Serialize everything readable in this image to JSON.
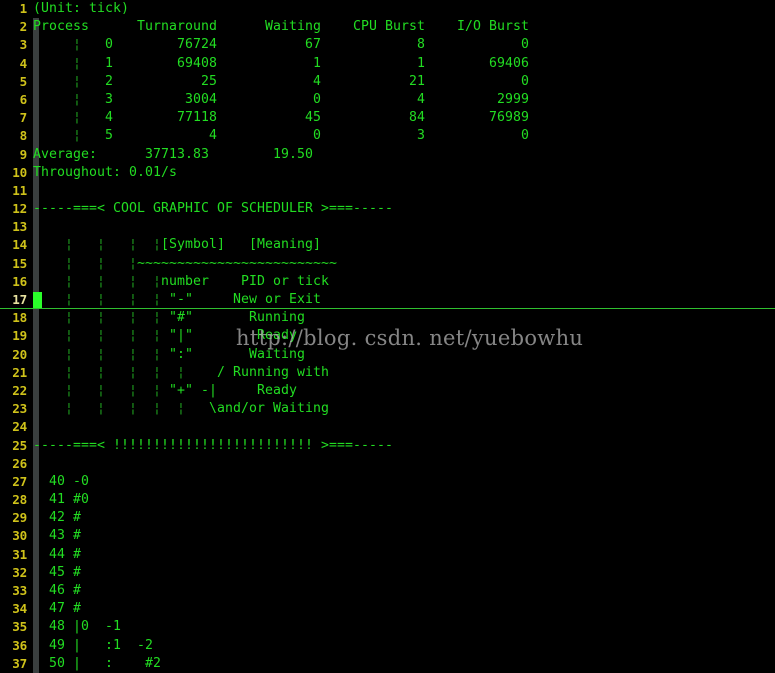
{
  "editor": {
    "kind": "terminal-text-editor",
    "background_color": "#000000",
    "text_color": "#22dd22",
    "linenumber_color": "#cfc21a",
    "cursorline_number_color": "#e8e2a0",
    "cursor_color": "#2aff2a",
    "indent_guide_color": "#3a3f3f",
    "cursor_line": 17,
    "first_line": 1,
    "last_line": 37
  },
  "watermark": {
    "text": "http://blog. csdn. net/yuebowhu"
  },
  "stats": {
    "unit_line": "(Unit: tick)",
    "columns": [
      "Process",
      "Turnaround",
      "Waiting",
      "CPU Burst",
      "I/O Burst"
    ],
    "rows": [
      {
        "process": "0",
        "turnaround": "76724",
        "waiting": "67",
        "cpu_burst": "8",
        "io_burst": "0"
      },
      {
        "process": "1",
        "turnaround": "69408",
        "waiting": "1",
        "cpu_burst": "1",
        "io_burst": "69406"
      },
      {
        "process": "2",
        "turnaround": "25",
        "waiting": "4",
        "cpu_burst": "21",
        "io_burst": "0"
      },
      {
        "process": "3",
        "turnaround": "3004",
        "waiting": "0",
        "cpu_burst": "4",
        "io_burst": "2999"
      },
      {
        "process": "4",
        "turnaround": "77118",
        "waiting": "45",
        "cpu_burst": "84",
        "io_burst": "76989"
      },
      {
        "process": "5",
        "turnaround": "4",
        "waiting": "0",
        "cpu_burst": "3",
        "io_burst": "0"
      }
    ],
    "average_label": "Average:",
    "average_turnaround": "37713.83",
    "average_waiting": "19.50",
    "throughout_line": "Throughout: 0.01/s"
  },
  "banners": {
    "graphic": "-----===< COOL GRAPHIC OF SCHEDULER >===-----",
    "bangs": "-----===< !!!!!!!!!!!!!!!!!!!!!!!!! >===-----"
  },
  "legend": {
    "header_symbol": "[Symbol]",
    "header_meaning": "[Meaning]",
    "rule": "~~~~~~~~~~~~~~~~~~~~~~~~",
    "entries": [
      {
        "symbol": "number",
        "meaning": "PID or tick"
      },
      {
        "symbol": "\"-\"",
        "meaning": "New or Exit"
      },
      {
        "symbol": "\"#\"",
        "meaning": "Running"
      },
      {
        "symbol": "\"|\"",
        "meaning": "Ready"
      },
      {
        "symbol": "\":\"",
        "meaning": "Waiting"
      },
      {
        "symbol": "\"+\"",
        "meaning": "/ Running with -| Ready \\and/or Waiting"
      }
    ]
  },
  "lines": [
    {
      "n": "1",
      "text": "(Unit: tick)",
      "indentbar": false,
      "cursor": false
    },
    {
      "n": "2",
      "text": "Process      Turnaround      Waiting    CPU Burst    I/O Burst",
      "indentbar": true,
      "cursor": false
    },
    {
      "n": "3",
      "text": "     ¦   0        76724           67            8            0",
      "indentbar": true,
      "cursor": false
    },
    {
      "n": "4",
      "text": "     ¦   1        69408            1            1        69406",
      "indentbar": true,
      "cursor": false
    },
    {
      "n": "5",
      "text": "     ¦   2           25            4           21            0",
      "indentbar": true,
      "cursor": false
    },
    {
      "n": "6",
      "text": "     ¦   3         3004            0            4         2999",
      "indentbar": true,
      "cursor": false
    },
    {
      "n": "7",
      "text": "     ¦   4        77118           45           84        76989",
      "indentbar": true,
      "cursor": false
    },
    {
      "n": "8",
      "text": "     ¦   5            4            0            3            0",
      "indentbar": true,
      "cursor": false
    },
    {
      "n": "9",
      "text": "Average:      37713.83        19.50",
      "indentbar": true,
      "cursor": false
    },
    {
      "n": "10",
      "text": "Throughout: 0.01/s",
      "indentbar": true,
      "cursor": false
    },
    {
      "n": "11",
      "text": "",
      "indentbar": true,
      "cursor": false
    },
    {
      "n": "12",
      "text": "-----===< COOL GRAPHIC OF SCHEDULER >===-----",
      "indentbar": true,
      "cursor": false
    },
    {
      "n": "13",
      "text": "",
      "indentbar": true,
      "cursor": false
    },
    {
      "n": "14",
      "text": "    ¦   ¦   ¦  ¦[Symbol]   [Meaning]",
      "indentbar": true,
      "cursor": false
    },
    {
      "n": "15",
      "text": "    ¦   ¦   ¦~~~~~~~~~~~~~~~~~~~~~~~~~",
      "indentbar": true,
      "cursor": false
    },
    {
      "n": "16",
      "text": "    ¦   ¦   ¦  ¦number    PID or tick",
      "indentbar": true,
      "cursor": false
    },
    {
      "n": "17",
      "text": "    ¦   ¦   ¦  ¦ \"-\"     New or Exit",
      "indentbar": true,
      "cursor": true
    },
    {
      "n": "18",
      "text": "    ¦   ¦   ¦  ¦ \"#\"       Running",
      "indentbar": true,
      "cursor": false
    },
    {
      "n": "19",
      "text": "    ¦   ¦   ¦  ¦ \"|\"        Ready",
      "indentbar": true,
      "cursor": false
    },
    {
      "n": "20",
      "text": "    ¦   ¦   ¦  ¦ \":\"       Waiting",
      "indentbar": true,
      "cursor": false
    },
    {
      "n": "21",
      "text": "    ¦   ¦   ¦  ¦  ¦    / Running with",
      "indentbar": true,
      "cursor": false
    },
    {
      "n": "22",
      "text": "    ¦   ¦   ¦  ¦ \"+\" -|     Ready",
      "indentbar": true,
      "cursor": false
    },
    {
      "n": "23",
      "text": "    ¦   ¦   ¦  ¦  ¦   \\and/or Waiting",
      "indentbar": true,
      "cursor": false
    },
    {
      "n": "24",
      "text": "",
      "indentbar": true,
      "cursor": false
    },
    {
      "n": "25",
      "text": "-----===< !!!!!!!!!!!!!!!!!!!!!!!!! >===-----",
      "indentbar": true,
      "cursor": false
    },
    {
      "n": "26",
      "text": "",
      "indentbar": true,
      "cursor": false
    },
    {
      "n": "27",
      "text": "  40 -0",
      "indentbar": true,
      "cursor": false
    },
    {
      "n": "28",
      "text": "  41 #0",
      "indentbar": true,
      "cursor": false
    },
    {
      "n": "29",
      "text": "  42 #",
      "indentbar": true,
      "cursor": false
    },
    {
      "n": "30",
      "text": "  43 #",
      "indentbar": true,
      "cursor": false
    },
    {
      "n": "31",
      "text": "  44 #",
      "indentbar": true,
      "cursor": false
    },
    {
      "n": "32",
      "text": "  45 #",
      "indentbar": true,
      "cursor": false
    },
    {
      "n": "33",
      "text": "  46 #",
      "indentbar": true,
      "cursor": false
    },
    {
      "n": "34",
      "text": "  47 #",
      "indentbar": true,
      "cursor": false
    },
    {
      "n": "35",
      "text": "  48 |0  -1",
      "indentbar": true,
      "cursor": false
    },
    {
      "n": "36",
      "text": "  49 |   :1  -2",
      "indentbar": true,
      "cursor": false
    },
    {
      "n": "37",
      "text": "  50 |   :    #2",
      "indentbar": true,
      "cursor": false
    }
  ]
}
